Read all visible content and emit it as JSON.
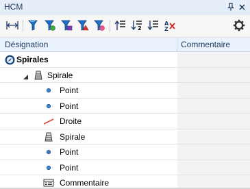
{
  "window": {
    "title": "HCM",
    "pin_icon": "pin-icon",
    "close_icon": "close-icon"
  },
  "toolbar": {
    "tools": [
      {
        "name": "fit-width-icon"
      },
      {
        "name": "filter-spiral-icon"
      },
      {
        "name": "filter-spiral-green-icon"
      },
      {
        "name": "filter-spiral-purple-icon"
      },
      {
        "name": "filter-spiral-red-icon"
      },
      {
        "name": "filter-spiral-pink-icon"
      },
      {
        "name": "sort-up-icon"
      },
      {
        "name": "sort-numbered-icon"
      },
      {
        "name": "sort-down-icon"
      },
      {
        "name": "sort-az-clear-icon"
      }
    ],
    "settings_icon": "gear-icon"
  },
  "grid": {
    "col_designation": "Désignation",
    "col_commentaire": "Commentaire",
    "rows": [
      {
        "label": "Spirales",
        "icon": "compass-icon",
        "level": 0,
        "bold": true
      },
      {
        "label": "Spirale",
        "icon": "spiral-icon",
        "level": 1,
        "expander": "collapse-triangle-icon"
      },
      {
        "label": "Point",
        "icon": "point-icon",
        "level": 2
      },
      {
        "label": "Point",
        "icon": "point-icon",
        "level": 2
      },
      {
        "label": "Droite",
        "icon": "line-icon",
        "level": 2
      },
      {
        "label": "Spirale",
        "icon": "spiral-icon",
        "level": 2
      },
      {
        "label": "Point",
        "icon": "point-icon",
        "level": 2
      },
      {
        "label": "Point",
        "icon": "point-icon",
        "level": 2
      },
      {
        "label": "Commentaire",
        "icon": "comment-icon",
        "level": 2
      }
    ]
  }
}
